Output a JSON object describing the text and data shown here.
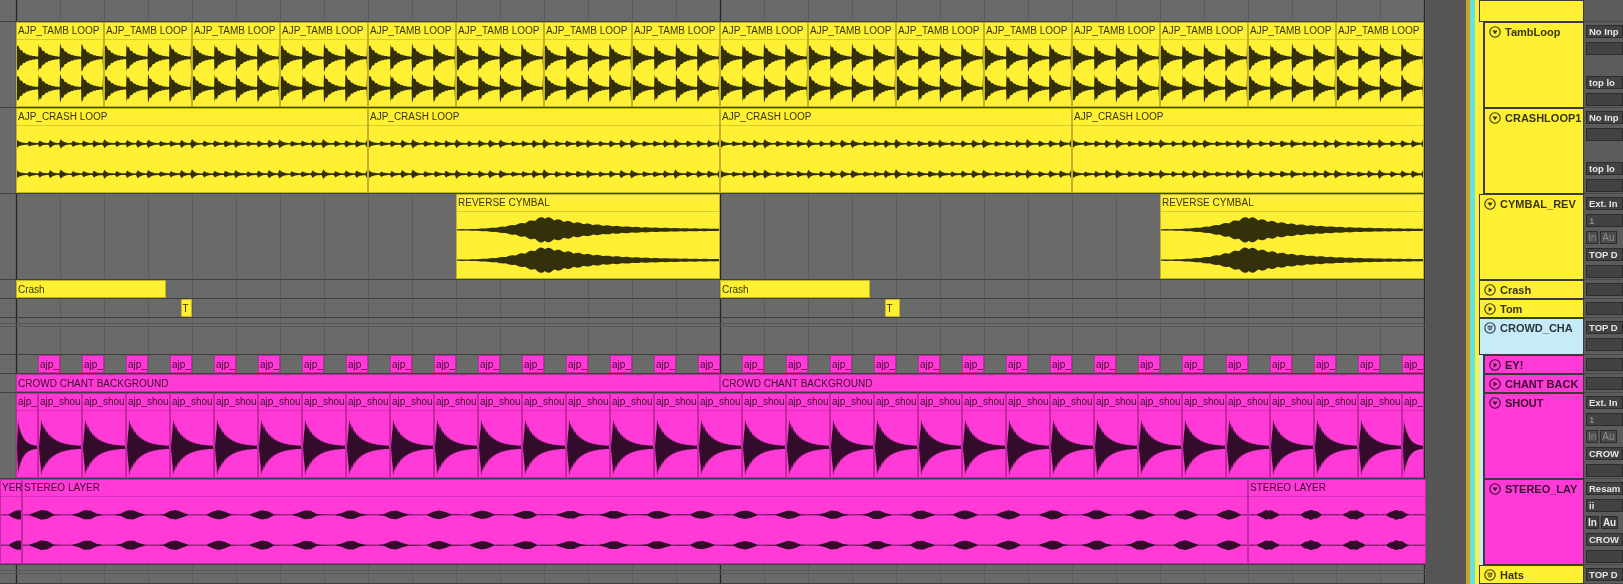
{
  "outer_groups": [
    {
      "color": "#c9a227"
    },
    {
      "color": "#61e3e6"
    },
    {
      "color": "#fff034"
    }
  ],
  "tracks": [
    {
      "kind": "group",
      "color": "#fff034",
      "children": [
        {
          "name": "TambLoop",
          "color": "#fff034",
          "expanded": true,
          "input": "No Inp",
          "output": "top lo",
          "clips": [
            {
              "name": "AJP_TAMB LOOP"
            },
            {
              "name": "AJP_TAMB LOOP"
            },
            {
              "name": "AJP_TAMB LOOP"
            },
            {
              "name": "AJP_TAMB LOOP"
            },
            {
              "name": "AJP_TAMB LOOP"
            },
            {
              "name": "AJP_TAMB LOOP"
            },
            {
              "name": "AJP_TAMB LOOP"
            },
            {
              "name": "AJP_TAMB LOOP"
            },
            {
              "name": "AJP_TAMB LOOP"
            },
            {
              "name": "AJP_TAMB LOOP"
            },
            {
              "name": "AJP_TAMB LOOP"
            },
            {
              "name": "AJP_TAMB LOOP"
            },
            {
              "name": "AJP_TAMB LOOP"
            },
            {
              "name": "AJP_TAMB LOOP"
            },
            {
              "name": "AJP_TAMB LOOP"
            },
            {
              "name": "AJP_TAMB LOOP"
            }
          ]
        },
        {
          "name": "CRASHLOOP1",
          "color": "#fff034",
          "expanded": true,
          "input": "No Inp",
          "output": "top lo",
          "clips": [
            {
              "name": "AJP_CRASH LOOP"
            },
            {
              "name": "AJP_CRASH LOOP"
            },
            {
              "name": "AJP_CRASH LOOP"
            },
            {
              "name": "AJP_CRASH LOOP"
            }
          ]
        }
      ]
    },
    {
      "name": "CYMBAL_REV",
      "color": "#fff034",
      "expanded": true,
      "input": "Ext. In",
      "channel": "1",
      "monitor": {
        "disabled": true,
        "labels": [
          "In",
          "Au"
        ]
      },
      "output": "TOP D",
      "clips": [
        {
          "name": "REVERSE CYMBAL"
        },
        {
          "name": "REVERSE CYMBAL"
        }
      ]
    },
    {
      "name": "Crash",
      "color": "#fff034",
      "expanded": false,
      "clips": [
        {
          "name": "Crash"
        },
        {
          "name": "Crash"
        }
      ]
    },
    {
      "name": "Tom",
      "color": "#fff034",
      "expanded": false,
      "clips": [
        {
          "name": "T"
        },
        {
          "name": "T"
        }
      ]
    },
    {
      "kind": "group",
      "name": "CROWD_CHA",
      "color": "#c6ecfa",
      "output": "TOP D",
      "children": [
        {
          "name": "EY!",
          "color": "#ff3ad6",
          "expanded": false,
          "clips": [
            {
              "name": "ajp_"
            },
            {
              "name": "ajp_"
            },
            {
              "name": "ajp_"
            },
            {
              "name": "ajp_"
            },
            {
              "name": "ajp_"
            },
            {
              "name": "ajp_"
            },
            {
              "name": "ajp_"
            },
            {
              "name": "ajp_"
            },
            {
              "name": "ajp_"
            },
            {
              "name": "ajp_"
            },
            {
              "name": "ajp_"
            },
            {
              "name": "ajp_"
            },
            {
              "name": "ajp_"
            },
            {
              "name": "ajp_"
            },
            {
              "name": "ajp_"
            },
            {
              "name": "ajp_"
            },
            {
              "name": "ajp_"
            },
            {
              "name": "ajp_"
            },
            {
              "name": "ajp_"
            },
            {
              "name": "ajp_"
            },
            {
              "name": "ajp_"
            },
            {
              "name": "ajp_"
            },
            {
              "name": "ajp_"
            },
            {
              "name": "ajp_"
            },
            {
              "name": "ajp_"
            },
            {
              "name": "ajp_"
            },
            {
              "name": "ajp_"
            },
            {
              "name": "ajp_"
            },
            {
              "name": "ajp_"
            },
            {
              "name": "ajp_"
            },
            {
              "name": "ajp_"
            },
            {
              "name": "ajp_"
            }
          ]
        },
        {
          "name": "CHANT BACK",
          "color": "#ff3ad6",
          "expanded": false,
          "clips": [
            {
              "name": "CROWD CHANT BACKGROUND"
            },
            {
              "name": "CROWD CHANT BACKGROUND"
            }
          ]
        },
        {
          "name": "SHOUT",
          "color": "#ff3ad6",
          "expanded": true,
          "input": "Ext. In",
          "channel": "1",
          "monitor": {
            "disabled": true,
            "labels": [
              "In",
              "Au"
            ]
          },
          "output": "CROW",
          "clips": [
            {
              "name": "ajp_"
            },
            {
              "name": "ajp_shou"
            },
            {
              "name": "ajp_shou"
            },
            {
              "name": "ajp_shou"
            },
            {
              "name": "ajp_shou"
            },
            {
              "name": "ajp_shou"
            },
            {
              "name": "ajp_shou"
            },
            {
              "name": "ajp_shou"
            },
            {
              "name": "ajp_shou"
            },
            {
              "name": "ajp_shou"
            },
            {
              "name": "ajp_shou"
            },
            {
              "name": "ajp_shou"
            },
            {
              "name": "ajp_shou"
            },
            {
              "name": "ajp_shou"
            },
            {
              "name": "ajp_shou"
            },
            {
              "name": "ajp_shou"
            },
            {
              "name": "ajp_shou"
            },
            {
              "name": "ajp_shou"
            },
            {
              "name": "ajp_shou"
            },
            {
              "name": "ajp_shou"
            },
            {
              "name": "ajp_shou"
            },
            {
              "name": "ajp_shou"
            },
            {
              "name": "ajp_shou"
            },
            {
              "name": "ajp_shou"
            },
            {
              "name": "ajp_shou"
            },
            {
              "name": "ajp_shou"
            },
            {
              "name": "ajp_shou"
            },
            {
              "name": "ajp_shou"
            },
            {
              "name": "ajp_shou"
            },
            {
              "name": "ajp_shou"
            },
            {
              "name": "ajp_shou"
            },
            {
              "name": "ajp_shou"
            },
            {
              "name": "ajp_"
            }
          ]
        },
        {
          "name": "STEREO_LAY",
          "color": "#ff3ad6",
          "expanded": true,
          "input": "Resam",
          "channel": "ii",
          "monitor": {
            "disabled": false,
            "labels": [
              "In",
              "Au"
            ]
          },
          "output": "CROW",
          "clips": [
            {
              "name": "YER"
            },
            {
              "name": "STEREO LAYER"
            },
            {
              "name": "STEREO LAYER"
            }
          ]
        }
      ]
    },
    {
      "kind": "group",
      "name": "Hats",
      "color": "#fff034",
      "output": "TOP D"
    }
  ]
}
